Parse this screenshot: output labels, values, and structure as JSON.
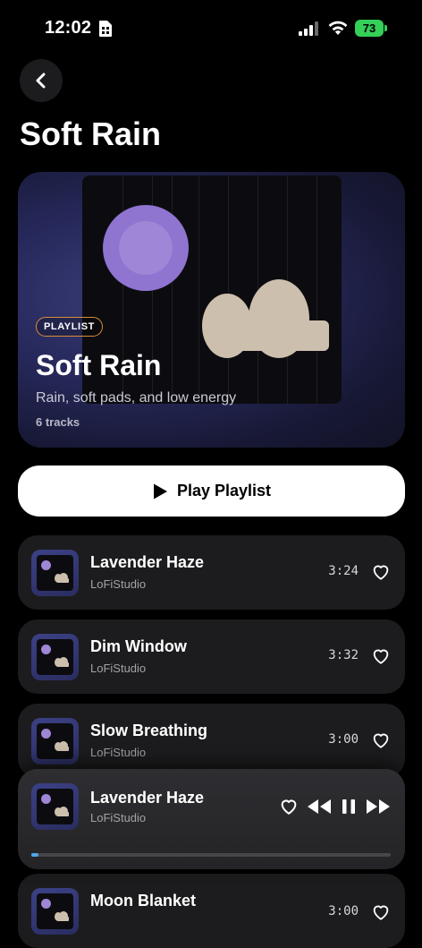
{
  "status": {
    "time": "12:02",
    "battery": "73"
  },
  "header": {
    "title": "Soft Rain"
  },
  "hero": {
    "badge": "PLAYLIST",
    "title": "Soft Rain",
    "description": "Rain, soft pads, and low energy",
    "count": "6 tracks"
  },
  "play_button": {
    "label": "Play Playlist"
  },
  "tracks": [
    {
      "title": "Lavender Haze",
      "artist": "LoFiStudio",
      "duration": "3:24"
    },
    {
      "title": "Dim Window",
      "artist": "LoFiStudio",
      "duration": "3:32"
    },
    {
      "title": "Slow Breathing",
      "artist": "LoFiStudio",
      "duration": "3:00"
    },
    {
      "title": "Moon Blanket",
      "artist": "",
      "duration": "3:00"
    }
  ],
  "now_playing": {
    "title": "Lavender Haze",
    "artist": "LoFiStudio",
    "progress": 0.02
  },
  "colors": {
    "accent": "#4fa6e8",
    "badge_border": "#d98d3c",
    "artwork_sun": "#9f86d6",
    "artwork_cloud": "#cdbfad"
  },
  "icons": [
    "back-chevron-icon",
    "play-icon",
    "heart-icon",
    "rewind-icon",
    "pause-icon",
    "fast-forward-icon",
    "signal-icon",
    "wifi-icon",
    "battery-icon"
  ]
}
